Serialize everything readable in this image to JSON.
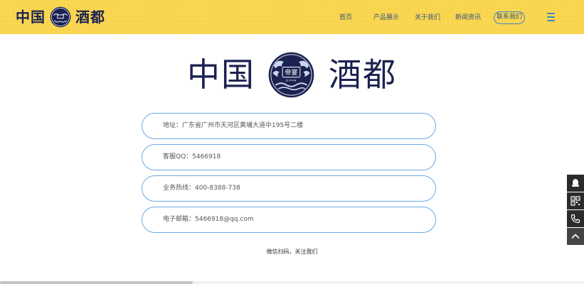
{
  "header": {
    "brand_left": "中国",
    "brand_right": "酒都",
    "nav": [
      {
        "label": "首页"
      },
      {
        "label": "产品展示"
      },
      {
        "label": "关于我们"
      },
      {
        "label": "新闻资讯"
      }
    ],
    "contact_label": "联系我们"
  },
  "logo": {
    "left": "中国",
    "right": "酒都",
    "seal_text": "帝宴",
    "seal_subtext": "DIYAN"
  },
  "contact": {
    "address": "地址：广东省广州市天河区黄埔大道中195号二楼",
    "qq": "客服QQ：5466918",
    "hotline": "业务热线：400-8388-738",
    "email": "电子邮箱：5466918@qq.com",
    "wechat_note": "微信扫码，关注我们"
  },
  "colors": {
    "header_bg": "#f9d54e",
    "brand_navy": "#1b2250",
    "accent_blue": "#3a86c8"
  },
  "float_bar": {
    "icons": [
      "qq-icon",
      "qr-code-icon",
      "phone-icon",
      "back-to-top-icon"
    ]
  }
}
